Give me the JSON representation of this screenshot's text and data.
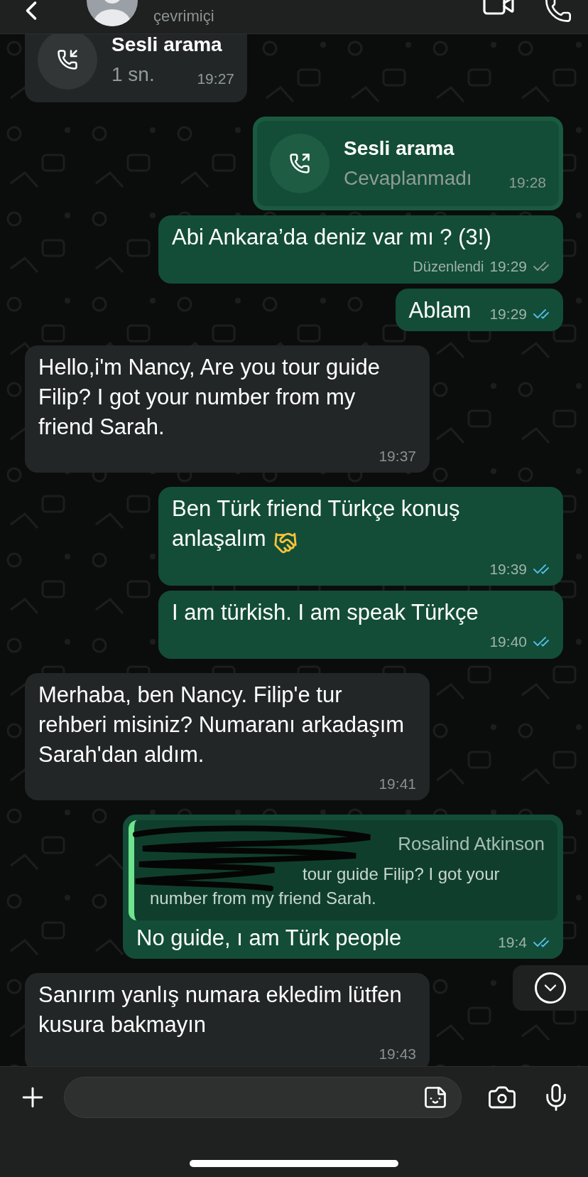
{
  "header": {
    "status": "çevrimiçi"
  },
  "messages": [
    {
      "kind": "call",
      "outgoing": false,
      "title": "Sesli arama",
      "detail": "1 sn.",
      "time": "19:27"
    },
    {
      "kind": "call",
      "outgoing": true,
      "title": "Sesli arama",
      "detail": "Cevaplanmadı",
      "time": "19:28"
    },
    {
      "kind": "text",
      "outgoing": true,
      "text": "Abi Ankara’da deniz var mı ? (3!)",
      "edited_label": "Düzenlendi",
      "time": "19:29",
      "read": false
    },
    {
      "kind": "text",
      "outgoing": true,
      "text": "Ablam",
      "time": "19:29",
      "read": true
    },
    {
      "kind": "text",
      "outgoing": false,
      "text": "Hello,i'm Nancy, Are you tour guide Filip? I got your number from my friend Sarah.",
      "time": "19:37"
    },
    {
      "kind": "text",
      "outgoing": true,
      "text": "Ben Türk friend Türkçe konuş anlaşalım",
      "handshake": true,
      "time": "19:39",
      "read": true
    },
    {
      "kind": "text",
      "outgoing": true,
      "text": "I am türkish. I am speak Türkçe",
      "time": "19:40",
      "read": true
    },
    {
      "kind": "text",
      "outgoing": false,
      "text": "Merhaba, ben Nancy. Filip'e tur rehberi misiniz? Numaranı arkadaşım Sarah'dan aldım.",
      "time": "19:41"
    },
    {
      "kind": "reply",
      "outgoing": true,
      "quote_author": "Rosalind Atkinson",
      "quote_text": "tour guide Filip? I got your number from my friend Sarah.",
      "text": "No guide, ı am Türk people",
      "time": "19:4",
      "read": true
    },
    {
      "kind": "text",
      "outgoing": false,
      "text": "Sanırım yanlış numara ekledim lütfen kusura bakmayın",
      "time": "19:43"
    }
  ]
}
